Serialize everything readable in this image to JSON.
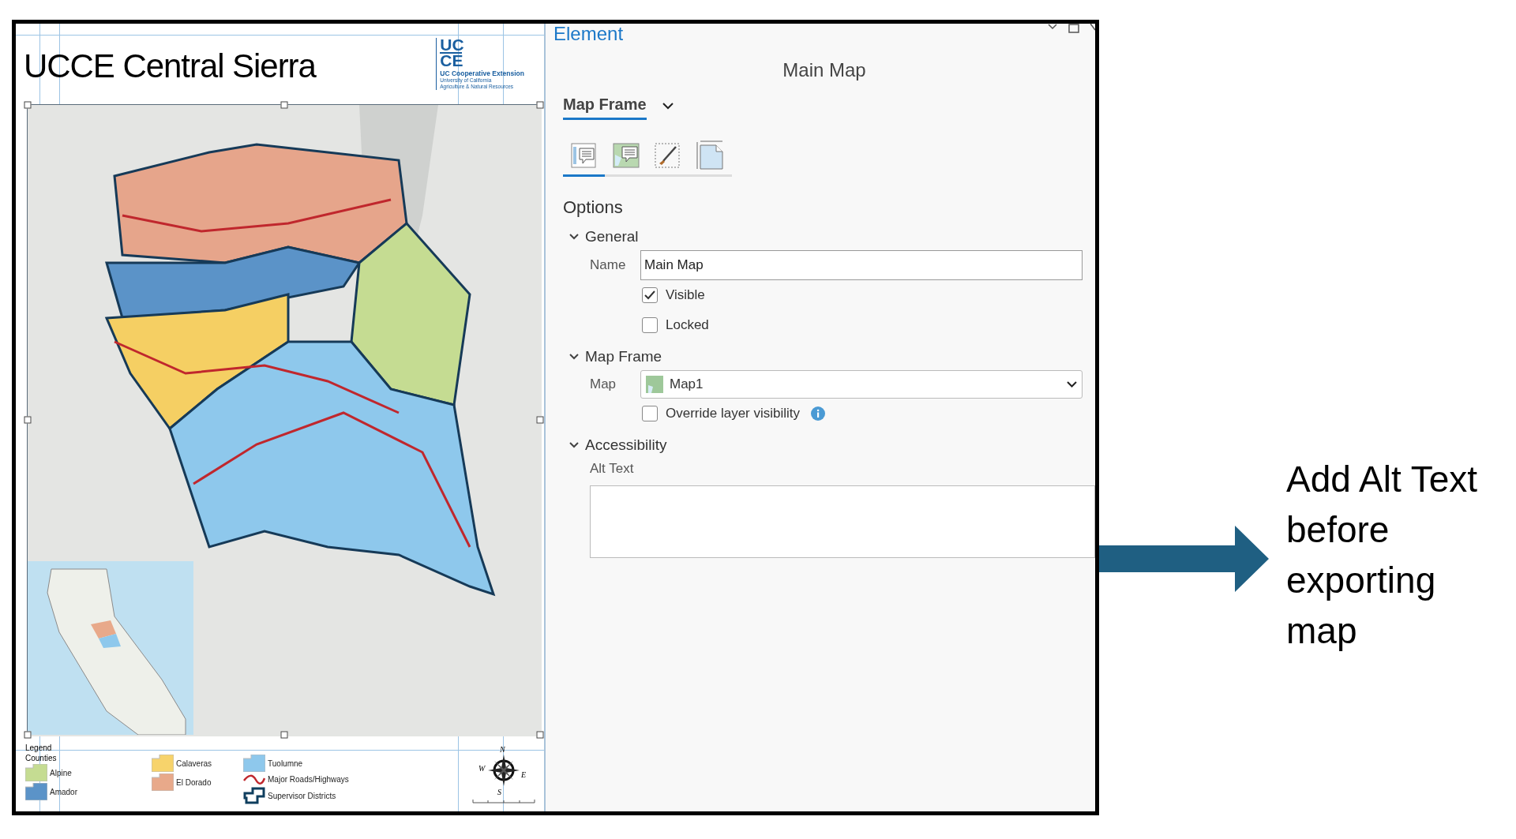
{
  "layout": {
    "title": "UCCE Central Sierra",
    "logo": {
      "mark_top": "UC",
      "mark_bottom": "CE",
      "name": "UC Cooperative Extension",
      "line_1": "University of California",
      "line_2": "Agriculture & Natural Resources"
    },
    "map_frame": {
      "selected": true,
      "kind": "picture"
    },
    "legend": {
      "title": "Legend",
      "group": "Counties",
      "columns": [
        [
          {
            "kind": "fill",
            "label": "Alpine",
            "color": "#c5dc92"
          },
          {
            "kind": "fill",
            "label": "Amador",
            "color": "#5b93c8"
          }
        ],
        [
          {
            "kind": "fill",
            "label": "Calaveras",
            "color": "#f7d36b"
          },
          {
            "kind": "fill",
            "label": "El Dorado",
            "color": "#e8a98a"
          }
        ],
        [
          {
            "kind": "fill",
            "label": "Tuolumne",
            "color": "#8ec8ec"
          },
          {
            "kind": "line",
            "label": "Major Roads/Highways",
            "color": "#c0272d"
          },
          {
            "kind": "outline",
            "label": "Supervisor Districts",
            "color": "#0f3e5e"
          }
        ]
      ]
    },
    "north_arrow": {
      "n": "N",
      "e": "E",
      "s": "S",
      "w": "W"
    }
  },
  "element_pane": {
    "title": "Element",
    "element_name": "Main Map",
    "selector": "Map Frame",
    "icon_tabs": [
      {
        "kind": "options",
        "selected": true
      },
      {
        "kind": "map-options",
        "selected": false
      },
      {
        "kind": "style",
        "selected": false
      },
      {
        "kind": "placement",
        "selected": false
      }
    ],
    "heading": "Options",
    "sections": [
      {
        "label": "General",
        "expanded": true,
        "rows": [
          {
            "kind": "text",
            "label": "Name",
            "value": "Main Map"
          },
          {
            "kind": "checkbox",
            "label": "Visible",
            "checked": true
          },
          {
            "kind": "checkbox",
            "label": "Locked",
            "checked": false
          }
        ]
      },
      {
        "label": "Map Frame",
        "expanded": true,
        "rows": [
          {
            "kind": "dropdown",
            "label": "Map",
            "value": "Map1"
          },
          {
            "kind": "checkbox",
            "label": "Override layer visibility",
            "checked": false,
            "info": true
          }
        ]
      },
      {
        "label": "Accessibility",
        "expanded": true,
        "rows": [
          {
            "kind": "textarea",
            "label": "Alt Text"
          }
        ]
      }
    ]
  },
  "annotation": {
    "text": "Add Alt Text before exporting map"
  }
}
